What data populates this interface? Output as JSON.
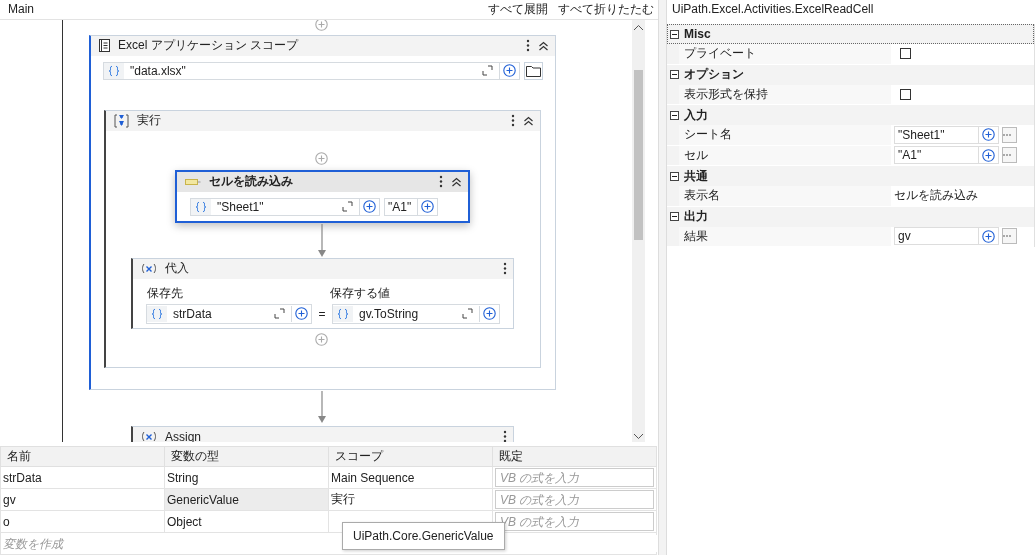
{
  "header": {
    "title": "Main",
    "actions": [
      "すべて展開",
      "すべて折りたたむ"
    ]
  },
  "designer": {
    "scope": {
      "title": "Excel アプリケーション スコープ",
      "path": "\"data.xlsx\"",
      "body": {
        "title": "実行",
        "read_cell": {
          "title": "セルを読み込み",
          "selected": true,
          "sheet": "\"Sheet1\"",
          "cell": "\"A1\""
        },
        "assign": {
          "title": "代入",
          "to_label": "保存先",
          "to": "strData",
          "operator": "=",
          "value_label": "保存する値",
          "value": "gv.ToString"
        }
      }
    },
    "next": {
      "title": "Assign"
    }
  },
  "variables": {
    "columns": [
      "名前",
      "変数の型",
      "スコープ",
      "既定"
    ],
    "rows": [
      {
        "name": "strData",
        "type": "String",
        "scope": "Main Sequence",
        "default_placeholder": "VB の式を入力",
        "type_hovered": false
      },
      {
        "name": "gv",
        "type": "GenericValue",
        "scope": "実行",
        "default_placeholder": "VB の式を入力",
        "type_hovered": true
      },
      {
        "name": "o",
        "type": "Object",
        "default_placeholder": "VB の式を入力",
        "type_hovered": false
      }
    ],
    "create_placeholder": "変数を作成",
    "tooltip": "UiPath.Core.GenericValue"
  },
  "properties": {
    "title": "UiPath.Excel.Activities.ExcelReadCell",
    "categories": [
      {
        "name": "Misc",
        "expanded": true,
        "selected": true,
        "items": [
          {
            "kind": "checkbox",
            "label": "プライベート",
            "checked": false
          }
        ]
      },
      {
        "name": "オプション",
        "expanded": true,
        "selected": false,
        "items": [
          {
            "kind": "checkbox",
            "label": "表示形式を保持",
            "checked": false
          }
        ]
      },
      {
        "name": "入力",
        "expanded": true,
        "selected": false,
        "items": [
          {
            "kind": "expression",
            "label": "シート名",
            "value": "\"Sheet1\""
          },
          {
            "kind": "expression",
            "label": "セル",
            "value": "\"A1\""
          }
        ]
      },
      {
        "name": "共通",
        "expanded": true,
        "selected": false,
        "items": [
          {
            "kind": "text",
            "label": "表示名",
            "value": "セルを読み込み"
          }
        ]
      },
      {
        "name": "出力",
        "expanded": true,
        "selected": false,
        "items": [
          {
            "kind": "expression",
            "label": "結果",
            "value": "gv"
          }
        ]
      }
    ]
  }
}
